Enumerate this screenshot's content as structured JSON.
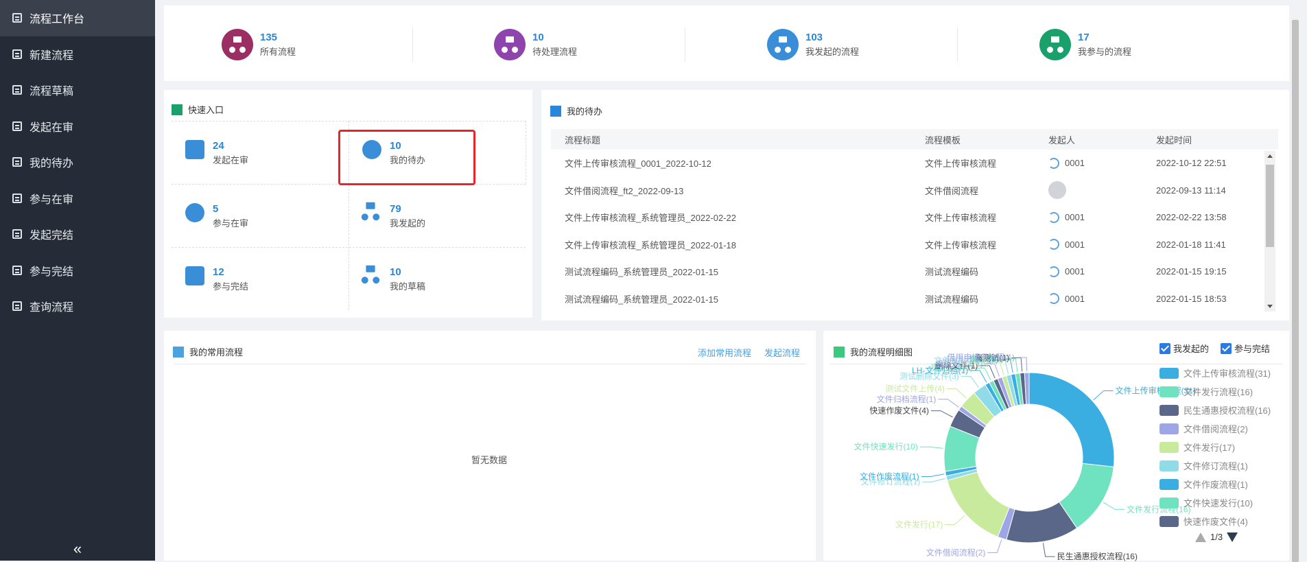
{
  "sidebar": {
    "items": [
      {
        "label": "流程工作台",
        "icon": "workbench-icon",
        "active": true
      },
      {
        "label": "新建流程",
        "icon": "new-flow-icon"
      },
      {
        "label": "流程草稿",
        "icon": "draft-icon"
      },
      {
        "label": "发起在审",
        "icon": "initiated-review-icon"
      },
      {
        "label": "我的待办",
        "icon": "todo-icon"
      },
      {
        "label": "参与在审",
        "icon": "participate-review-icon"
      },
      {
        "label": "发起完结",
        "icon": "initiated-done-icon"
      },
      {
        "label": "参与完结",
        "icon": "participate-done-icon"
      },
      {
        "label": "查询流程",
        "icon": "search-flow-icon"
      }
    ],
    "collapse": "«"
  },
  "stats": [
    {
      "num": "135",
      "label": "所有流程",
      "color": "#9b2f63"
    },
    {
      "num": "10",
      "label": "待处理流程",
      "color": "#8e44ad"
    },
    {
      "num": "103",
      "label": "我发起的流程",
      "color": "#3a8ed8"
    },
    {
      "num": "17",
      "label": "我参与的流程",
      "color": "#1aa06a"
    }
  ],
  "quick": {
    "title": "快速入口",
    "items": [
      {
        "num": "24",
        "label": "发起在审"
      },
      {
        "num": "10",
        "label": "我的待办"
      },
      {
        "num": "5",
        "label": "参与在审"
      },
      {
        "num": "79",
        "label": "我发起的"
      },
      {
        "num": "12",
        "label": "参与完结"
      },
      {
        "num": "10",
        "label": "我的草稿"
      }
    ]
  },
  "todo": {
    "title": "我的待办",
    "headers": [
      "流程标题",
      "流程模板",
      "发起人",
      "发起时间"
    ],
    "rows": [
      {
        "title": "文件上传审核流程_0001_2022-10-12",
        "template": "文件上传审核流程",
        "user": "0001",
        "time": "2022-10-12 22:51"
      },
      {
        "title": "文件借阅流程_ft2_2022-09-13",
        "template": "文件借阅流程",
        "user": "",
        "time": "2022-09-13 11:14"
      },
      {
        "title": "文件上传审核流程_系统管理员_2022-02-22",
        "template": "文件上传审核流程",
        "user": "0001",
        "time": "2022-02-22 13:58"
      },
      {
        "title": "文件上传审核流程_系统管理员_2022-01-18",
        "template": "文件上传审核流程",
        "user": "0001",
        "time": "2022-01-18 11:41"
      },
      {
        "title": "测试流程编码_系统管理员_2022-01-15",
        "template": "测试流程编码",
        "user": "0001",
        "time": "2022-01-15 19:15"
      },
      {
        "title": "测试流程编码_系统管理员_2022-01-15",
        "template": "测试流程编码",
        "user": "0001",
        "time": "2022-01-15 18:53"
      }
    ]
  },
  "common": {
    "title": "我的常用流程",
    "add_label": "添加常用流程",
    "start_label": "发起流程",
    "empty": "暂无数据"
  },
  "mine": {
    "title": "我的流程明细图",
    "check1": "我发起的",
    "check2": "参与完结",
    "pager": "1/3"
  },
  "chart_data": {
    "type": "pie",
    "title": "我的流程明细图",
    "legend": "right",
    "legend_page": "1/3",
    "series": [
      {
        "name": "文件上传审核流程",
        "value": 31,
        "color": "#3aaee0"
      },
      {
        "name": "文件发行流程",
        "value": 16,
        "color": "#6fe3bf"
      },
      {
        "name": "民生通惠授权流程",
        "value": 16,
        "color": "#5b6789"
      },
      {
        "name": "文件借阅流程",
        "value": 2,
        "color": "#9fa6e6"
      },
      {
        "name": "文件发行",
        "value": 17,
        "color": "#c7ea9c"
      },
      {
        "name": "文件修订流程",
        "value": 1,
        "color": "#8fdbe8"
      },
      {
        "name": "文件作废流程",
        "value": 1,
        "color": "#3aaee0"
      },
      {
        "name": "文件快速发行",
        "value": 10,
        "color": "#6fe3bf"
      },
      {
        "name": "快速作废文件",
        "value": 4,
        "color": "#5b6789"
      },
      {
        "name": "文件归档流程",
        "value": 1,
        "color": "#9fa6e6"
      },
      {
        "name": "测试文件上传",
        "value": 4,
        "color": "#c7ea9c"
      },
      {
        "name": "测试删除文件",
        "value": 3,
        "color": "#8fdbe8"
      },
      {
        "name": "LH-文件归档",
        "value": 1,
        "color": "#3aaee0"
      },
      {
        "name": "测试上传",
        "value": 1,
        "color": "#6fe3bf"
      },
      {
        "name": "删除文件",
        "value": 1,
        "color": "#5b6789"
      },
      {
        "name": "流程测试",
        "value": 1,
        "color": "#9fa6e6"
      },
      {
        "name": "rwer",
        "value": 1,
        "color": "#c7ea9c"
      },
      {
        "name": "文件复制申请",
        "value": 1,
        "color": "#8fdbe8"
      },
      {
        "name": "0917",
        "value": 1,
        "color": "#3aaee0"
      },
      {
        "name": "海思特",
        "value": 1,
        "color": "#6fe3bf"
      },
      {
        "name": "海测试",
        "value": 1,
        "color": "#5b6789"
      },
      {
        "name": "借用申请单流程",
        "value": 1,
        "color": "#9fa6e6"
      }
    ],
    "labels": [
      "文件上传审核流程(31)",
      "文件发行流程(16)",
      "民生通惠授权流程(16)",
      "文件借阅流程(2)",
      "文件发行(17)",
      "文件修订流程(1)",
      "文件作废流程(1)",
      "文件快速发行(10)",
      "快速作废文件(4)",
      "文件归档流程(1)",
      "测试文件上传(4)",
      "测试删除文件(3)",
      "LH-文件归档(1)",
      "测试上传(1)",
      "删除文件(1)",
      "流程测试1(1)",
      "rwer(1)",
      "文件复制申请(1)",
      "0917(1)",
      "海思特(1)",
      "海测试(1)",
      "借用申请单流程(1)"
    ],
    "legend_items": [
      {
        "label": "文件上传审核流程(31)",
        "color": "#3aaee0"
      },
      {
        "label": "文件发行流程(16)",
        "color": "#6fe3bf"
      },
      {
        "label": "民生通惠授权流程(16)",
        "color": "#5b6789"
      },
      {
        "label": "文件借阅流程(2)",
        "color": "#9fa6e6"
      },
      {
        "label": "文件发行(17)",
        "color": "#c7ea9c"
      },
      {
        "label": "文件修订流程(1)",
        "color": "#8fdbe8"
      },
      {
        "label": "文件作废流程(1)",
        "color": "#3aaee0"
      },
      {
        "label": "文件快速发行(10)",
        "color": "#6fe3bf"
      },
      {
        "label": "快速作废文件(4)",
        "color": "#5b6789"
      }
    ]
  }
}
